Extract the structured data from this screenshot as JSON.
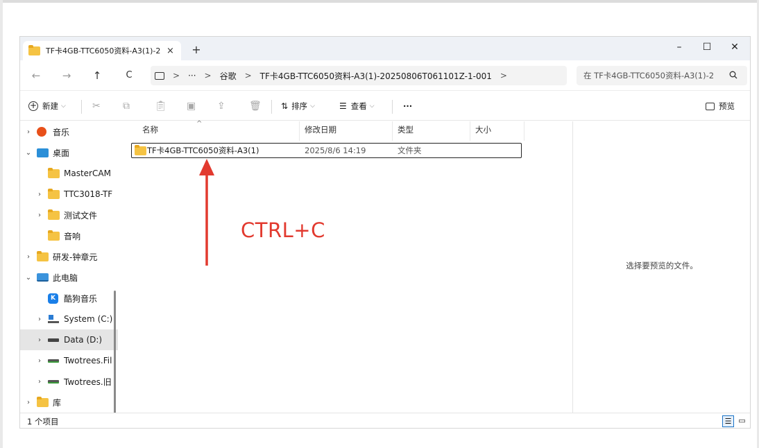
{
  "tab": {
    "title": "TF卡4GB-TTC6050资料-A3(1)-2",
    "close": "×",
    "new_tab": "+"
  },
  "window_controls": {
    "minimize": "–",
    "maximize": "☐",
    "close": "✕"
  },
  "nav": {
    "back": "←",
    "forward": "→",
    "up": "↑",
    "refresh": "C"
  },
  "breadcrumb": {
    "more": "···",
    "items": [
      "谷歌",
      "TF卡4GB-TTC6050资料-A3(1)-20250806T061101Z-1-001"
    ],
    "separator": ">"
  },
  "search": {
    "placeholder": "在 TF卡4GB-TTC6050资料-A3(1)-2",
    "icon": "search-icon"
  },
  "toolbar": {
    "new_label": "新建",
    "sort_label": "排序",
    "view_label": "查看",
    "more": "···",
    "preview_label": "预览"
  },
  "sidebar": {
    "items": [
      {
        "label": "音乐",
        "icon": "music-icon",
        "expandable": true
      },
      {
        "label": "桌面",
        "icon": "desktop-icon",
        "expanded": true
      },
      {
        "label": "MasterCAM",
        "icon": "folder-icon"
      },
      {
        "label": "TTC3018-TF",
        "icon": "folder-icon",
        "expandable": true
      },
      {
        "label": "测试文件",
        "icon": "folder-icon",
        "expandable": true
      },
      {
        "label": "音响",
        "icon": "folder-icon"
      },
      {
        "label": "研发-钟章元",
        "icon": "folder-icon",
        "expandable": true
      },
      {
        "label": "此电脑",
        "icon": "pc-icon",
        "expanded": true
      },
      {
        "label": "酷狗音乐",
        "icon": "kugou-icon"
      },
      {
        "label": "System (C:)",
        "icon": "windows-drive-icon",
        "expandable": true
      },
      {
        "label": "Data (D:)",
        "icon": "drive-icon",
        "expandable": true,
        "selected": true
      },
      {
        "label": "Twotrees.Fil",
        "icon": "network-drive-icon",
        "expandable": true
      },
      {
        "label": "Twotrees.旧",
        "icon": "network-drive-icon",
        "expandable": true
      },
      {
        "label": "库",
        "icon": "folder-icon",
        "expandable": true
      }
    ]
  },
  "columns": {
    "name": "名称",
    "modified": "修改日期",
    "type": "类型",
    "size": "大小"
  },
  "files": [
    {
      "name": "TF卡4GB-TTC6050资料-A3(1)",
      "modified": "2025/8/6 14:19",
      "type": "文件夹",
      "size": ""
    }
  ],
  "annotation": {
    "text": "CTRL+C",
    "color": "#e23a2f"
  },
  "preview": {
    "empty_text": "选择要预览的文件。"
  },
  "status": {
    "count": "1 个项目"
  },
  "colors": {
    "folder": "#f5c343",
    "accent": "#1a73c7",
    "selection": "#e5e5e5"
  }
}
